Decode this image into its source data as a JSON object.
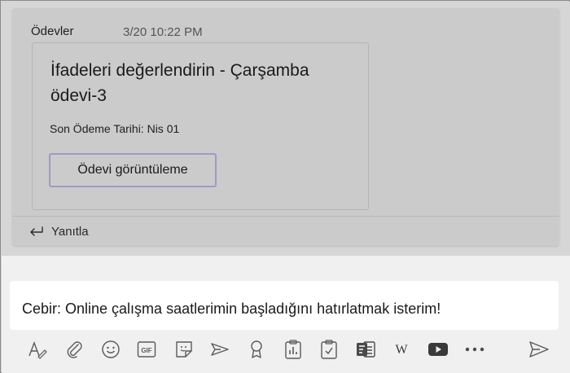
{
  "message": {
    "sender": "Ödevler",
    "timestamp": "3/20 10:22 PM"
  },
  "assignment_card": {
    "title": "İfadeleri değerlendirin - Çarşamba ödevi-3",
    "due_label": "Son Ödeme Tarihi: Nis 01",
    "view_button_label": "Ödevi görüntüleme"
  },
  "reply": {
    "label": "Yanıtla"
  },
  "compose": {
    "text": "Cebir: Online çalışma saatlerimin başladığını hatırlatmak isterim!"
  },
  "toolbar": {
    "icons": [
      "format-icon",
      "attach-icon",
      "emoji-icon",
      "gif-icon",
      "sticker-icon",
      "meet-icon",
      "praise-icon",
      "insights-icon",
      "assignments-icon",
      "forms-icon",
      "wikipedia-icon",
      "youtube-icon",
      "more-icon",
      "send-icon"
    ],
    "gif_label": "GIF",
    "wiki_label": "W"
  },
  "colors": {
    "accent": "#6264a7",
    "button_border": "#9e9ac8",
    "overlay": "#cbcbcb"
  }
}
